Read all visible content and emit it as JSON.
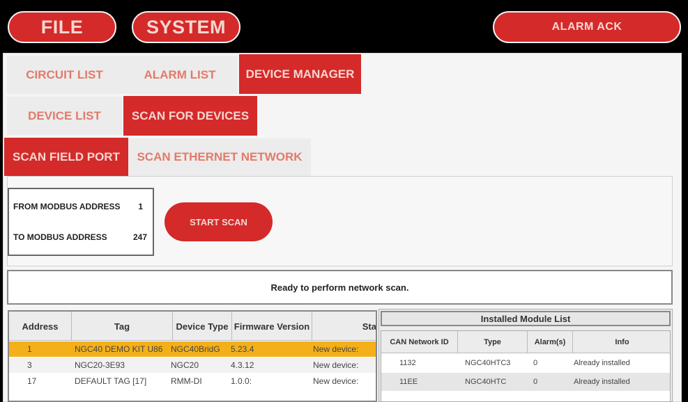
{
  "topbar": {
    "file_label": "FILE",
    "system_label": "SYSTEM",
    "alarm_ack_label": "ALARM ACK"
  },
  "tabs_row1": [
    {
      "label": "CIRCUIT LIST",
      "active": false
    },
    {
      "label": "ALARM LIST",
      "active": false
    },
    {
      "label": "DEVICE MANAGER",
      "active": true
    }
  ],
  "tabs_row2": [
    {
      "label": "DEVICE LIST",
      "active": false
    },
    {
      "label": "SCAN FOR DEVICES",
      "active": true
    }
  ],
  "tabs_row3": [
    {
      "label": "SCAN FIELD PORT",
      "active": true
    },
    {
      "label": "SCAN ETHERNET NETWORK",
      "active": false
    }
  ],
  "scan": {
    "from_label": "FROM MODBUS ADDRESS",
    "from_value": "1",
    "to_label": "TO MODBUS ADDRESS",
    "to_value": "247",
    "start_label": "START SCAN",
    "status": "Ready to perform network scan."
  },
  "devices": {
    "columns": [
      "Address",
      "Tag",
      "Device Type",
      "Firmware Version",
      "Sta"
    ],
    "rows": [
      {
        "address": "1",
        "tag": "NGC40 DEMO KIT U86",
        "type": "NGC40BridG",
        "firmware": "5.23.4",
        "status": "New device:",
        "selected": true
      },
      {
        "address": "3",
        "tag": "NGC20-3E93",
        "type": "NGC20",
        "firmware": "4.3.12",
        "status": "New device:",
        "selected": false
      },
      {
        "address": "17",
        "tag": "DEFAULT TAG [17]",
        "type": "RMM-DI",
        "firmware": "1.0.0:",
        "status": "New device:",
        "selected": false
      }
    ]
  },
  "modules": {
    "title": "Installed Module List",
    "columns": [
      "CAN Network ID",
      "Type",
      "Alarm(s)",
      "Info"
    ],
    "rows": [
      {
        "id": "1132",
        "type": "NGC40HTC3",
        "alarms": "0",
        "info": "Already installed"
      },
      {
        "id": "11EE",
        "type": "NGC40HTC",
        "alarms": "0",
        "info": "Already installed"
      }
    ]
  },
  "colors": {
    "accent_red": "#d42a2a",
    "selected_row": "#f4b01a",
    "inactive_tab_text": "#e27a6a"
  }
}
